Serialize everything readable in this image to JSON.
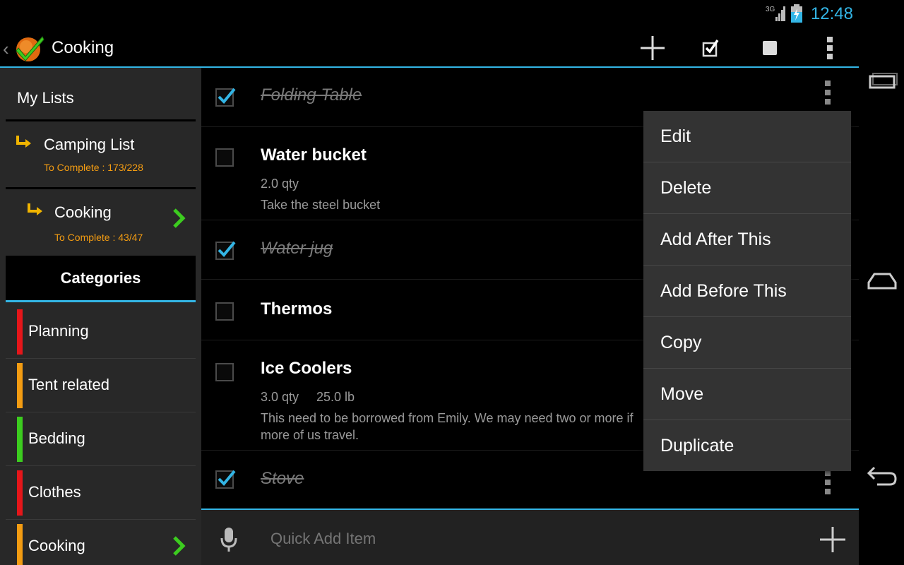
{
  "status": {
    "time": "12:48",
    "network": "3G"
  },
  "actionbar": {
    "title": "Cooking"
  },
  "sidebar": {
    "title": "My Lists",
    "lists": [
      {
        "name": "Camping List",
        "sub": "To Complete : 173/228"
      },
      {
        "name": "Cooking",
        "sub": "To Complete : 43/47"
      }
    ],
    "categories_title": "Categories",
    "categories": [
      {
        "label": "Planning",
        "color": "#e5161a"
      },
      {
        "label": "Tent related",
        "color": "#f39c12"
      },
      {
        "label": "Bedding",
        "color": "#3ccc1f"
      },
      {
        "label": "Clothes",
        "color": "#e5161a"
      },
      {
        "label": "Cooking",
        "color": "#f39c12"
      }
    ]
  },
  "items": [
    {
      "name": "Folding Table",
      "checked": true
    },
    {
      "name": "Water bucket",
      "checked": false,
      "qty": "2.0 qty",
      "note": "Take the steel bucket"
    },
    {
      "name": "Water jug",
      "checked": true
    },
    {
      "name": "Thermos",
      "checked": false
    },
    {
      "name": "Ice Coolers",
      "checked": false,
      "qty": "3.0 qty",
      "weight": "25.0 lb",
      "note": "This need to be borrowed from Emily. We may need two or more if more of us travel."
    },
    {
      "name": "Stove",
      "checked": true
    }
  ],
  "popup_menu": [
    "Edit",
    "Delete",
    "Add After This",
    "Add Before This",
    "Copy",
    "Move",
    "Duplicate"
  ],
  "quick_add": {
    "placeholder": "Quick Add Item"
  },
  "colors": {
    "accent": "#33b5e5",
    "orange": "#f39c12",
    "green": "#3ccc1f"
  }
}
